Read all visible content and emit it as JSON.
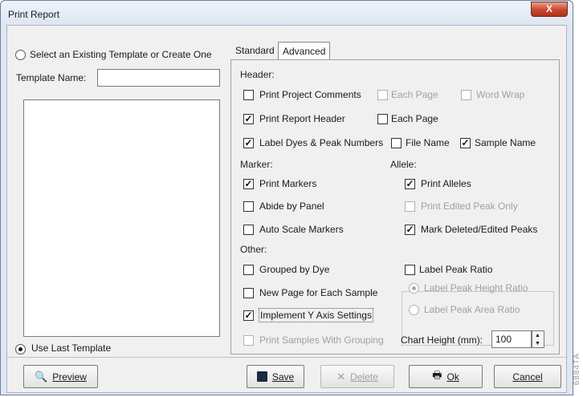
{
  "window": {
    "title": "Print Report",
    "close_label": "X"
  },
  "left": {
    "select_template_label": "Select an Existing Template or Create One",
    "template_name_label": "Template Name:",
    "template_name_value": "",
    "use_last_template_label": "Use Last Template"
  },
  "tabs": {
    "standard": "Standard",
    "advanced": "Advanced"
  },
  "header_section": {
    "title": "Header:",
    "print_project_comments": "Print Project Comments",
    "each_page_1": "Each Page",
    "word_wrap": "Word Wrap",
    "print_report_header": "Print Report Header",
    "each_page_2": "Each Page",
    "label_dyes": "Label Dyes & Peak Numbers",
    "file_name": "File Name",
    "sample_name": "Sample Name"
  },
  "marker_section": {
    "title": "Marker:",
    "print_markers": "Print Markers",
    "abide_by_panel": "Abide by Panel",
    "auto_scale_markers": "Auto Scale Markers"
  },
  "allele_section": {
    "title": "Allele:",
    "print_alleles": "Print Alleles",
    "print_edited_peak_only": "Print Edited Peak Only",
    "mark_deleted_edited": "Mark Deleted/Edited Peaks"
  },
  "other_section": {
    "title": "Other:",
    "grouped_by_dye": "Grouped by Dye",
    "new_page_each_sample": "New Page for Each Sample",
    "implement_y_axis": "Implement  Y Axis Settings",
    "print_samples_grouping": "Print Samples With Grouping"
  },
  "peak_ratio": {
    "label_peak_ratio": "Label Peak Ratio",
    "height_ratio": "Label Peak Height Ratio",
    "area_ratio": "Label Peak Area Ratio"
  },
  "chart_height": {
    "label": "Chart Height (mm):",
    "value": "100"
  },
  "buttons": {
    "preview": "Preview",
    "save": "Save",
    "delete": "Delete",
    "ok": "Ok",
    "cancel": "Cancel"
  },
  "figure_code": "6884TA"
}
